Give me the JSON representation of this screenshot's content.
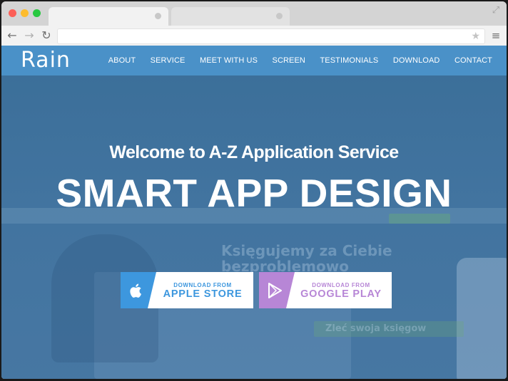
{
  "browser": {
    "address_value": "",
    "icons": {
      "back": "arrow-left-icon",
      "forward": "arrow-right-icon",
      "reload": "reload-icon",
      "bookmark": "star-icon",
      "menu": "hamburger-menu-icon",
      "fullscreen": "expand-icon"
    }
  },
  "site": {
    "logo": "Rain",
    "nav": [
      "ABOUT",
      "SERVICE",
      "MEET WITH US",
      "SCREEN",
      "TESTIMONIALS",
      "DOWNLOAD",
      "CONTACT"
    ],
    "hero": {
      "subtitle": "Welcome to A-Z Application Service",
      "title": "SMART APP DESIGN"
    },
    "background_text": {
      "headline_line1": "Księgujemy za Ciebie",
      "headline_line2": "bezproblemowo",
      "cta": "Zleć swoja księgow"
    },
    "buttons": {
      "apple": {
        "small": "DOWNLOAD FROM",
        "big": "APPLE STORE",
        "icon": "apple-icon"
      },
      "google": {
        "small": "DOWNLOAD FROM",
        "big": "GOOGLE PLAY",
        "icon": "play-icon"
      }
    }
  },
  "colors": {
    "nav_bg": "#4a91c8",
    "hero_overlay": "#3d6f99",
    "apple_accent": "#3d97de",
    "google_accent": "#b786d6"
  }
}
